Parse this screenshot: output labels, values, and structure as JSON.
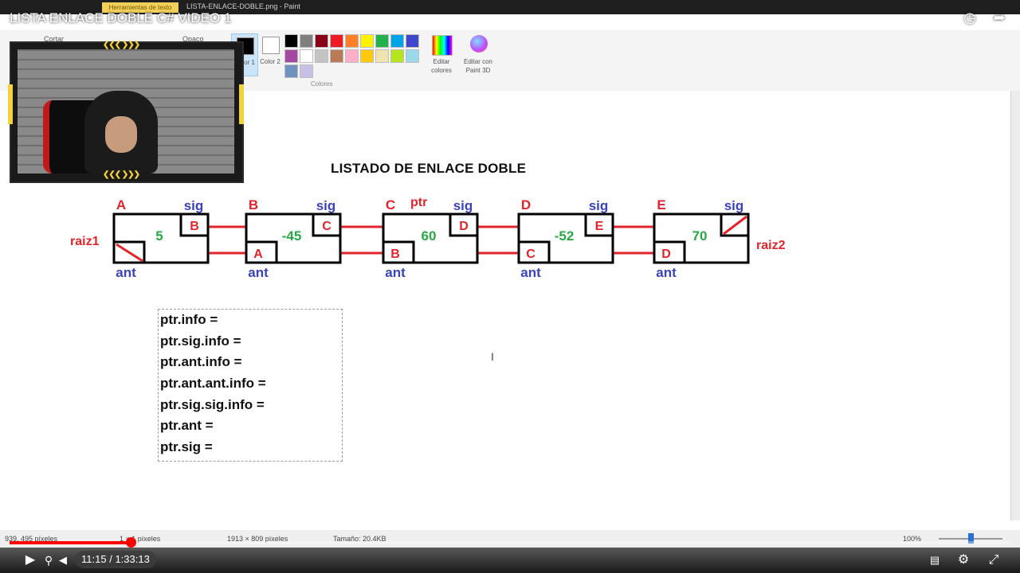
{
  "video": {
    "title": "LISTA ENLACE DOBLE C# VIDEO 1",
    "current_time": "11:15",
    "time_separator": "/",
    "duration": "1:33:13",
    "progress": 0.1207
  },
  "paint": {
    "window_title": "LISTA-ENLACE-DOBLE.png - Paint",
    "context_tab": "Herramientas de texto",
    "ribbon": {
      "cut_label": "Cortar",
      "opaque_label": "Opaco",
      "color1_label": "Color 1",
      "color2_label": "Color 2",
      "colors_group_label": "Colores",
      "edit_colors_label": "Editar colores",
      "edit_paint3d_label": "Editar con Paint 3D",
      "palette": [
        "#000000",
        "#7f7f7f",
        "#880015",
        "#ed1c24",
        "#ff7f27",
        "#fff200",
        "#22b14c",
        "#00a2e8",
        "#3f48cc",
        "#a349a4",
        "#ffffff",
        "#c3c3c3",
        "#b97a57",
        "#ffaec9",
        "#ffc90e",
        "#efe4b0",
        "#b5e61d",
        "#99d9ea",
        "#7092be",
        "#c8bfe7"
      ]
    },
    "statusbar": {
      "cursor_pos": "939, 495 píxeles",
      "selection_size": "1 × 1 píxeles",
      "image_size": "1913 × 809 píxeles",
      "file_size": "Tamaño: 20.4KB",
      "zoom": "100%"
    }
  },
  "diagram": {
    "title": "LISTADO DE ENLACE DOBLE",
    "colors": {
      "red": "#e1252b",
      "blue": "#3b43b9",
      "green": "#2aa745"
    },
    "root_left_label": "raiz1",
    "root_right_label": "raiz2",
    "pointer_label": "ptr",
    "next_label": "sig",
    "prev_label": "ant",
    "nodes": [
      {
        "name": "A",
        "info": "5",
        "sig": "B",
        "ant": ""
      },
      {
        "name": "B",
        "info": "-45",
        "sig": "C",
        "ant": "A"
      },
      {
        "name": "C",
        "info": "60",
        "sig": "D",
        "ant": "B"
      },
      {
        "name": "D",
        "info": "-52",
        "sig": "E",
        "ant": "C"
      },
      {
        "name": "E",
        "info": "70",
        "sig": "",
        "ant": "D"
      }
    ],
    "code_lines": [
      "ptr.info =",
      "ptr.sig.info =",
      "ptr.ant.info =",
      "ptr.ant.ant.info =",
      "ptr.sig.sig.info =",
      "ptr.ant =",
      "ptr.sig ="
    ]
  },
  "icons": {
    "watch_later": "clock-icon",
    "share": "share-arrow-icon",
    "play": "play-icon",
    "search": "search-icon",
    "volume": "volume-icon",
    "subtitles": "subtitles-icon",
    "settings": "gear-icon",
    "exit_fullscreen": "exit-fullscreen-icon"
  }
}
